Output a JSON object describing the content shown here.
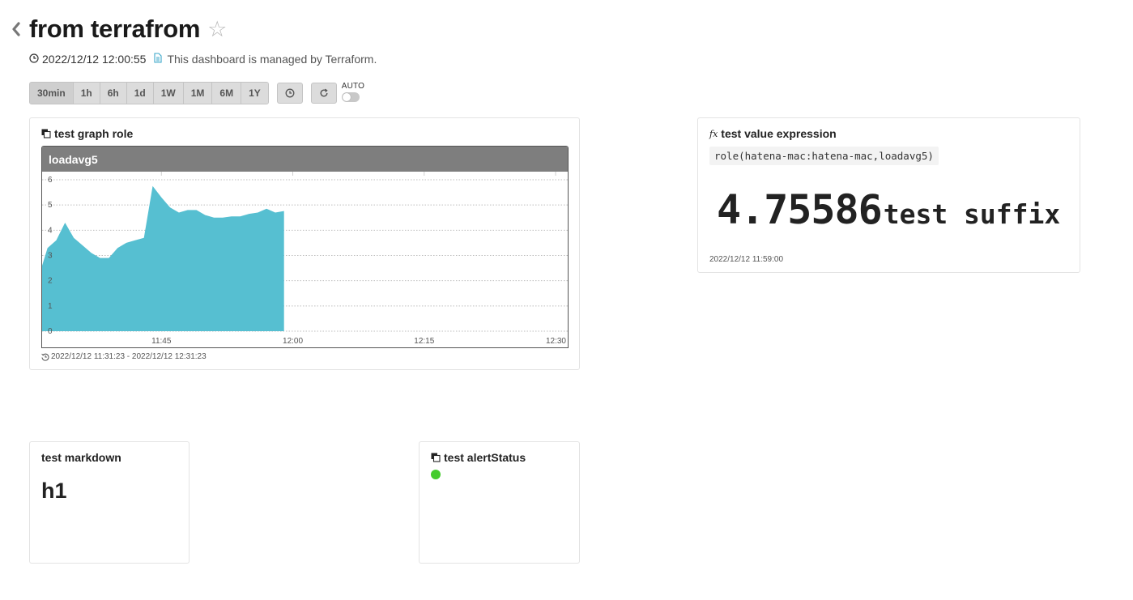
{
  "header": {
    "title": "from terrafrom",
    "updated_at": "2022/12/12 12:00:55",
    "managed_note": "This dashboard is managed by Terraform."
  },
  "toolbar": {
    "ranges": [
      "30min",
      "1h",
      "6h",
      "1d",
      "1W",
      "1M",
      "6M",
      "1Y"
    ],
    "auto_label": "AUTO",
    "auto_enabled": false
  },
  "graph_widget": {
    "title": "test graph role",
    "graph_title": "loadavg5",
    "time_range": "2022/12/12 11:31:23 - 2022/12/12 12:31:23",
    "series_color": "#56bfd1",
    "chart_data": {
      "type": "area",
      "series": [
        {
          "x": [
            "11:31",
            "11:32",
            "11:33",
            "11:34",
            "11:35",
            "11:36",
            "11:37",
            "11:38",
            "11:39",
            "11:40",
            "11:41",
            "11:42",
            "11:43",
            "11:44",
            "11:45",
            "11:46",
            "11:47",
            "11:48",
            "11:49",
            "11:50",
            "11:51",
            "11:52",
            "11:53",
            "11:54",
            "11:55",
            "11:56",
            "11:57",
            "11:58",
            "11:59"
          ],
          "values": [
            2.6,
            3.3,
            3.6,
            4.3,
            3.7,
            3.4,
            3.1,
            2.9,
            2.9,
            3.3,
            3.5,
            3.6,
            3.7,
            5.75,
            5.3,
            4.9,
            4.7,
            4.8,
            4.8,
            4.6,
            4.5,
            4.5,
            4.55,
            4.55,
            4.65,
            4.7,
            4.85,
            4.7,
            4.76
          ]
        }
      ],
      "y_ticks": [
        0,
        1,
        2,
        3,
        4,
        5,
        6
      ],
      "x_ticks": [
        "11:45",
        "12:00",
        "12:15",
        "12:30"
      ],
      "ylim": [
        0,
        6
      ],
      "xlim": [
        "11:31",
        "12:31"
      ],
      "grid": true
    }
  },
  "value_widget": {
    "title": "test value expression",
    "expression": "role(hatena-mac:hatena-mac,loadavg5)",
    "value": "4.75586",
    "suffix": "test suffix",
    "timestamp": "2022/12/12 11:59:00"
  },
  "markdown_widget": {
    "title": "test markdown",
    "h1": "h1"
  },
  "alert_widget": {
    "title": "test alertStatus",
    "status_color": "#44cc2c"
  }
}
